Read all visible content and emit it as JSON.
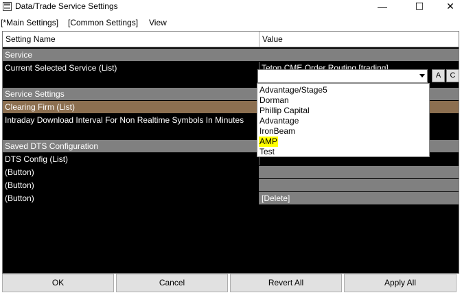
{
  "window": {
    "title": "Data/Trade Service Settings",
    "minimize": "—",
    "maximize": "☐",
    "close": "✕"
  },
  "menu": [
    "[*Main Settings]",
    "[Common Settings]",
    "View"
  ],
  "grid": {
    "headers": {
      "name": "Setting Name",
      "value": "Value"
    },
    "rows": [
      {
        "name": "Service",
        "value": ""
      },
      {
        "name": "Current Selected Service (List)",
        "value": "Teton CME Order Routing    [trading]"
      },
      {
        "name": "Service Settings",
        "value": ""
      },
      {
        "name": "Clearing Firm (List)",
        "value": ""
      },
      {
        "name": "Intraday Download Interval For Non Realtime Symbols In Minutes",
        "value": ""
      },
      {
        "name": "Saved DTS Configuration",
        "value": ""
      },
      {
        "name": "DTS Config (List)",
        "value": ""
      },
      {
        "name": " (Button)",
        "value": ""
      },
      {
        "name": " (Button)",
        "value": ""
      },
      {
        "name": " (Button)",
        "value": "[Delete]"
      }
    ]
  },
  "combo": {
    "btn_a": "A",
    "btn_c": "C"
  },
  "dropdown": {
    "options": [
      "Advantage/Stage5",
      "Dorman",
      "Phillip Capital",
      "Advantage",
      "IronBeam",
      "AMP",
      "Test"
    ],
    "highlighted": "AMP"
  },
  "buttons": {
    "ok": "OK",
    "cancel": "Cancel",
    "revert": "Revert All",
    "apply": "Apply All"
  },
  "colors": {
    "grid_bg": "#000000",
    "section_bg": "#808080",
    "selected_row_bg": "#8c6f50",
    "highlight": "#ffff00"
  }
}
